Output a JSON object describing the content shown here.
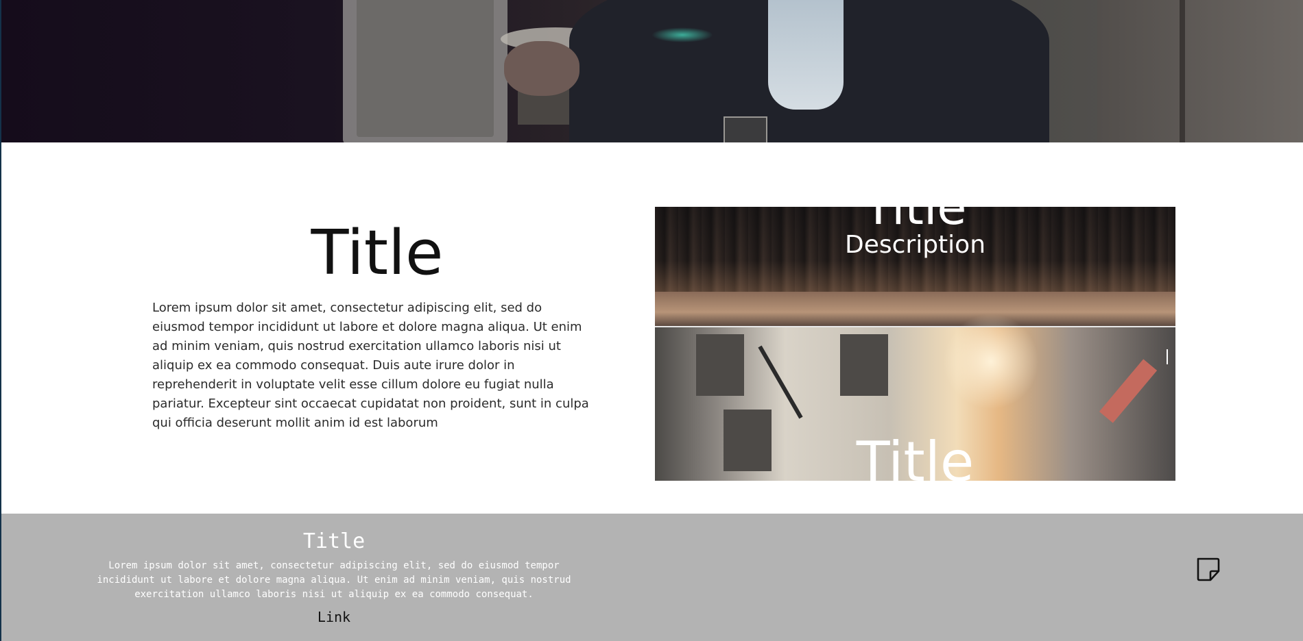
{
  "content": {
    "title": "Title",
    "body": "Lorem ipsum dolor sit amet, consectetur adipiscing elit, sed do eiusmod tempor incididunt ut labore et dolore magna aliqua. Ut enim ad minim veniam, quis nostrud exercitation ullamco laboris nisi ut aliquip ex ea commodo consequat. Duis aute irure dolor in reprehenderit in voluptate velit esse cillum dolore eu fugiat nulla pariatur. Excepteur sint occaecat cupidatat non proident, sunt in culpa qui officia deserunt mollit anim id est laborum"
  },
  "slider": {
    "slide_1": {
      "title": "Title",
      "description": "Description"
    },
    "slide_2": {
      "title": "Title"
    }
  },
  "footer": {
    "title": "Title",
    "body": "Lorem ipsum dolor sit amet, consectetur adipiscing elit, sed do eiusmod tempor incididunt ut labore et dolore magna aliqua. Ut enim ad minim veniam, quis nostrud exercitation ullamco laboris nisi ut aliquip ex ea commodo consequat.",
    "link_label": "Link",
    "note_icon": "sticky-note-icon"
  },
  "colors": {
    "footer_background": "#b3b3b3",
    "title_text": "#111111",
    "footer_text": "#ffffff"
  }
}
